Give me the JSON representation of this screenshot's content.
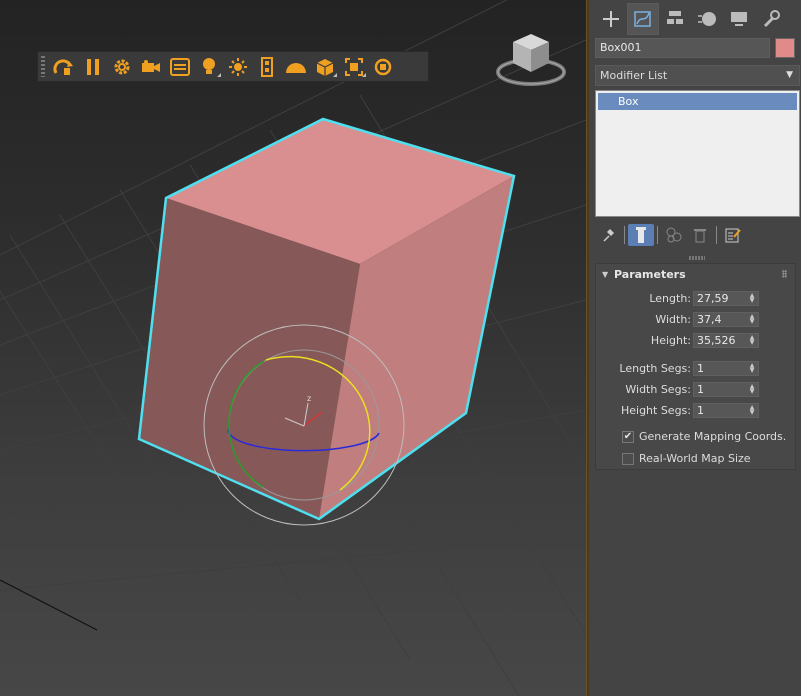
{
  "viewport": {
    "toolbar": {
      "buttons": [
        "orbit-icon",
        "pause-icon",
        "settings-gear-icon",
        "camera-icon",
        "menu-bars-icon",
        "light-bulb-icon",
        "sun-icon",
        "film-icon",
        "dome-light-icon",
        "box-icon",
        "frame-icon",
        "reset-icon"
      ]
    },
    "viewcube": {
      "top_label": "",
      "front_label": ""
    },
    "gizmo_axis_z": "z"
  },
  "command_panel": {
    "tabs": [
      "create-icon",
      "modify-icon",
      "hierarchy-icon",
      "motion-icon",
      "display-icon",
      "utilities-icon"
    ],
    "active_tab": "modify",
    "object_name": "Box001",
    "object_color": "#e08a8a",
    "modifier_list": {
      "label": "Modifier List",
      "arrow": "▼"
    },
    "stack": [
      "Box"
    ],
    "stack_tools": [
      "pin-stack-icon",
      "show-end-result-icon",
      "make-unique-icon",
      "remove-modifier-icon",
      "configure-modifier-sets-icon"
    ],
    "parameters": {
      "title": "Parameters",
      "fields": [
        {
          "label": "Length:",
          "value": "27,59"
        },
        {
          "label": "Width:",
          "value": "37,4"
        },
        {
          "label": "Height:",
          "value": "35,526"
        }
      ],
      "segs": [
        {
          "label": "Length Segs:",
          "value": "1"
        },
        {
          "label": "Width Segs:",
          "value": "1"
        },
        {
          "label": "Height Segs:",
          "value": "1"
        }
      ],
      "options": [
        {
          "label": "Generate Mapping Coords.",
          "checked": true
        },
        {
          "label": "Real-World Map Size",
          "checked": false
        }
      ]
    }
  },
  "colors": {
    "accent_orange": "#f0a020",
    "selection_cyan": "#4fe0f0",
    "box_front": "#8a5a5a",
    "box_right": "#c08080",
    "box_top": "#d89090",
    "stack_highlight": "#6a8bbd"
  }
}
